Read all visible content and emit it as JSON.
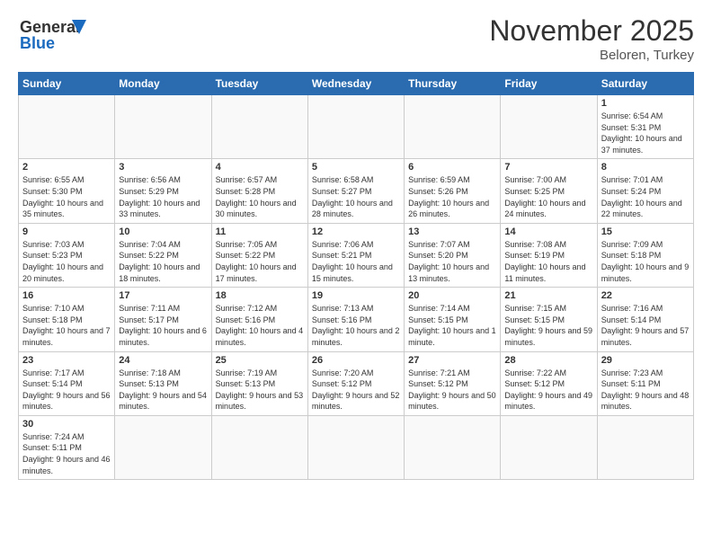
{
  "logo": {
    "line1": "General",
    "line2": "Blue"
  },
  "title": "November 2025",
  "location": "Beloren, Turkey",
  "days_header": [
    "Sunday",
    "Monday",
    "Tuesday",
    "Wednesday",
    "Thursday",
    "Friday",
    "Saturday"
  ],
  "weeks": [
    [
      {
        "day": "",
        "info": ""
      },
      {
        "day": "",
        "info": ""
      },
      {
        "day": "",
        "info": ""
      },
      {
        "day": "",
        "info": ""
      },
      {
        "day": "",
        "info": ""
      },
      {
        "day": "",
        "info": ""
      },
      {
        "day": "1",
        "info": "Sunrise: 6:54 AM\nSunset: 5:31 PM\nDaylight: 10 hours and 37 minutes."
      }
    ],
    [
      {
        "day": "2",
        "info": "Sunrise: 6:55 AM\nSunset: 5:30 PM\nDaylight: 10 hours and 35 minutes."
      },
      {
        "day": "3",
        "info": "Sunrise: 6:56 AM\nSunset: 5:29 PM\nDaylight: 10 hours and 33 minutes."
      },
      {
        "day": "4",
        "info": "Sunrise: 6:57 AM\nSunset: 5:28 PM\nDaylight: 10 hours and 30 minutes."
      },
      {
        "day": "5",
        "info": "Sunrise: 6:58 AM\nSunset: 5:27 PM\nDaylight: 10 hours and 28 minutes."
      },
      {
        "day": "6",
        "info": "Sunrise: 6:59 AM\nSunset: 5:26 PM\nDaylight: 10 hours and 26 minutes."
      },
      {
        "day": "7",
        "info": "Sunrise: 7:00 AM\nSunset: 5:25 PM\nDaylight: 10 hours and 24 minutes."
      },
      {
        "day": "8",
        "info": "Sunrise: 7:01 AM\nSunset: 5:24 PM\nDaylight: 10 hours and 22 minutes."
      }
    ],
    [
      {
        "day": "9",
        "info": "Sunrise: 7:03 AM\nSunset: 5:23 PM\nDaylight: 10 hours and 20 minutes."
      },
      {
        "day": "10",
        "info": "Sunrise: 7:04 AM\nSunset: 5:22 PM\nDaylight: 10 hours and 18 minutes."
      },
      {
        "day": "11",
        "info": "Sunrise: 7:05 AM\nSunset: 5:22 PM\nDaylight: 10 hours and 17 minutes."
      },
      {
        "day": "12",
        "info": "Sunrise: 7:06 AM\nSunset: 5:21 PM\nDaylight: 10 hours and 15 minutes."
      },
      {
        "day": "13",
        "info": "Sunrise: 7:07 AM\nSunset: 5:20 PM\nDaylight: 10 hours and 13 minutes."
      },
      {
        "day": "14",
        "info": "Sunrise: 7:08 AM\nSunset: 5:19 PM\nDaylight: 10 hours and 11 minutes."
      },
      {
        "day": "15",
        "info": "Sunrise: 7:09 AM\nSunset: 5:18 PM\nDaylight: 10 hours and 9 minutes."
      }
    ],
    [
      {
        "day": "16",
        "info": "Sunrise: 7:10 AM\nSunset: 5:18 PM\nDaylight: 10 hours and 7 minutes."
      },
      {
        "day": "17",
        "info": "Sunrise: 7:11 AM\nSunset: 5:17 PM\nDaylight: 10 hours and 6 minutes."
      },
      {
        "day": "18",
        "info": "Sunrise: 7:12 AM\nSunset: 5:16 PM\nDaylight: 10 hours and 4 minutes."
      },
      {
        "day": "19",
        "info": "Sunrise: 7:13 AM\nSunset: 5:16 PM\nDaylight: 10 hours and 2 minutes."
      },
      {
        "day": "20",
        "info": "Sunrise: 7:14 AM\nSunset: 5:15 PM\nDaylight: 10 hours and 1 minute."
      },
      {
        "day": "21",
        "info": "Sunrise: 7:15 AM\nSunset: 5:15 PM\nDaylight: 9 hours and 59 minutes."
      },
      {
        "day": "22",
        "info": "Sunrise: 7:16 AM\nSunset: 5:14 PM\nDaylight: 9 hours and 57 minutes."
      }
    ],
    [
      {
        "day": "23",
        "info": "Sunrise: 7:17 AM\nSunset: 5:14 PM\nDaylight: 9 hours and 56 minutes."
      },
      {
        "day": "24",
        "info": "Sunrise: 7:18 AM\nSunset: 5:13 PM\nDaylight: 9 hours and 54 minutes."
      },
      {
        "day": "25",
        "info": "Sunrise: 7:19 AM\nSunset: 5:13 PM\nDaylight: 9 hours and 53 minutes."
      },
      {
        "day": "26",
        "info": "Sunrise: 7:20 AM\nSunset: 5:12 PM\nDaylight: 9 hours and 52 minutes."
      },
      {
        "day": "27",
        "info": "Sunrise: 7:21 AM\nSunset: 5:12 PM\nDaylight: 9 hours and 50 minutes."
      },
      {
        "day": "28",
        "info": "Sunrise: 7:22 AM\nSunset: 5:12 PM\nDaylight: 9 hours and 49 minutes."
      },
      {
        "day": "29",
        "info": "Sunrise: 7:23 AM\nSunset: 5:11 PM\nDaylight: 9 hours and 48 minutes."
      }
    ],
    [
      {
        "day": "30",
        "info": "Sunrise: 7:24 AM\nSunset: 5:11 PM\nDaylight: 9 hours and 46 minutes."
      },
      {
        "day": "",
        "info": ""
      },
      {
        "day": "",
        "info": ""
      },
      {
        "day": "",
        "info": ""
      },
      {
        "day": "",
        "info": ""
      },
      {
        "day": "",
        "info": ""
      },
      {
        "day": "",
        "info": ""
      }
    ]
  ]
}
